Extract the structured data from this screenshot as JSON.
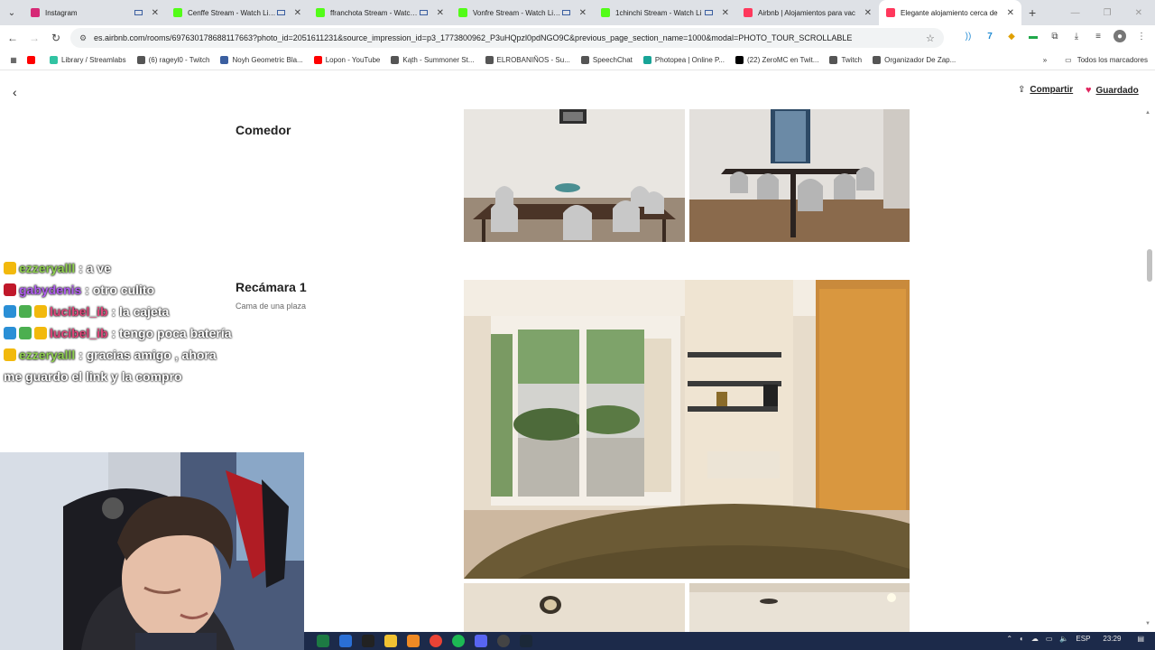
{
  "browser": {
    "tabs": [
      {
        "label": "Instagram",
        "color": "#d62976",
        "cast": true
      },
      {
        "label": "Cenffe Stream - Watch Live on K",
        "color": "#53fc18",
        "cast": true
      },
      {
        "label": "ffranchota Stream - Watch Li",
        "color": "#53fc18",
        "cast": true
      },
      {
        "label": "Vonfre Stream - Watch Live on",
        "color": "#53fc18",
        "cast": true
      },
      {
        "label": "1chinchi Stream - Watch Li",
        "color": "#53fc18",
        "cast": true
      },
      {
        "label": "Airbnb | Alojamientos para vac",
        "color": "#ff385c",
        "cast": false
      },
      {
        "label": "Elegante alojamiento cerca de",
        "color": "#ff385c",
        "cast": false
      }
    ],
    "url": "es.airbnb.com/rooms/697630178688117663?photo_id=2051611231&source_impression_id=p3_1773800962_P3uHQpzl0pdNGO9C&previous_page_section_name=1000&modal=PHOTO_TOUR_SCROLLABLE",
    "bookmarks": [
      {
        "label": "",
        "color": "#ff0000"
      },
      {
        "label": "Library / Streamlabs",
        "color": "#31c3a2"
      },
      {
        "label": "(6) rageyl0 - Twitch",
        "color": "#555555"
      },
      {
        "label": "Noyh Geometric Bla...",
        "color": "#3b5fa0"
      },
      {
        "label": "Lopon - YouTube",
        "color": "#ff0000"
      },
      {
        "label": "Kąth - Summoner St...",
        "color": "#555555"
      },
      {
        "label": "ELROBANIÑOS - Su...",
        "color": "#555555"
      },
      {
        "label": "SpeechChat",
        "color": "#555555"
      },
      {
        "label": "Photopea | Online P...",
        "color": "#18a497"
      },
      {
        "label": "(22) ZeroMC en Twit...",
        "color": "#000000"
      },
      {
        "label": "Twitch",
        "color": "#555555"
      },
      {
        "label": "Organizador De Zap...",
        "color": "#555555"
      }
    ],
    "all_bookmarks": "Todos los marcadores"
  },
  "header": {
    "share_label": "Compartir",
    "saved_label": "Guardado"
  },
  "sections": [
    {
      "title": "Comedor",
      "subtitle": ""
    },
    {
      "title": "Recámara 1",
      "subtitle": "Cama de una plaza"
    }
  ],
  "chat": [
    {
      "badges": [
        "#f2b90d"
      ],
      "user": "ezzeryalll",
      "user_color": "#8fd14f",
      "text": ": a ve"
    },
    {
      "badges": [
        "#c0182a"
      ],
      "user": "gabydenis",
      "user_color": "#b05cf0",
      "text": ": otro culito"
    },
    {
      "badges": [
        "#2a8fd6",
        "#4caf50",
        "#f2b90d"
      ],
      "user": "lucibel_ib",
      "user_color": "#e0457a",
      "text": ": la cajeta"
    },
    {
      "badges": [
        "#2a8fd6",
        "#4caf50",
        "#f2b90d"
      ],
      "user": "lucibel_ib",
      "user_color": "#e0457a",
      "text": ": tengo poca batería"
    },
    {
      "badges": [
        "#f2b90d"
      ],
      "user": "ezzeryalll",
      "user_color": "#8fd14f",
      "text": ": gracias amigo , ahora me guardo el link y la compro"
    }
  ],
  "tray": {
    "lang": "ESP",
    "time": "23:29"
  }
}
